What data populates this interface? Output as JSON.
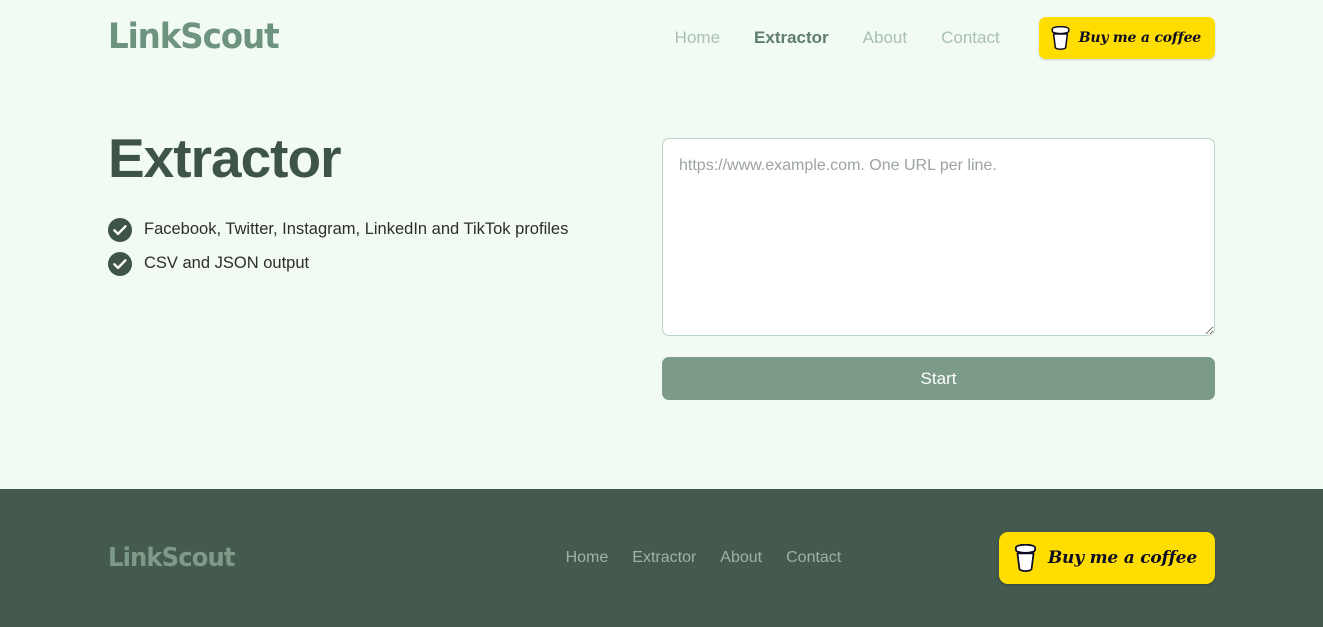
{
  "brand": {
    "name": "LinkScout"
  },
  "header": {
    "nav": [
      {
        "label": "Home",
        "active": false
      },
      {
        "label": "Extractor",
        "active": true
      },
      {
        "label": "About",
        "active": false
      },
      {
        "label": "Contact",
        "active": false
      }
    ],
    "coffee_button": {
      "label": "Buy me a coffee",
      "icon": "coffee-cup-icon",
      "background": "#ffdd00",
      "text_color": "#0d0c22"
    }
  },
  "main": {
    "title": "Extractor",
    "features": [
      {
        "icon": "check-circle-icon",
        "text": "Facebook, Twitter, Instagram, LinkedIn and TikTok profiles"
      },
      {
        "icon": "check-circle-icon",
        "text": "CSV and JSON output"
      }
    ],
    "url_input": {
      "placeholder": "https://www.example.com. One URL per line.",
      "value": ""
    },
    "start_button": {
      "label": "Start",
      "background": "#7b9b88"
    }
  },
  "footer": {
    "brand": "LinkScout",
    "nav": [
      {
        "label": "Home"
      },
      {
        "label": "Extractor"
      },
      {
        "label": "About"
      },
      {
        "label": "Contact"
      }
    ],
    "coffee_button": {
      "label": "Buy me a coffee",
      "icon": "coffee-cup-icon"
    }
  },
  "colors": {
    "page_background": "#f2fbf3",
    "footer_background": "#455a4e",
    "brand_green": "#6e9480",
    "heading_green": "#3f5448",
    "accent_yellow": "#ffdd00"
  }
}
